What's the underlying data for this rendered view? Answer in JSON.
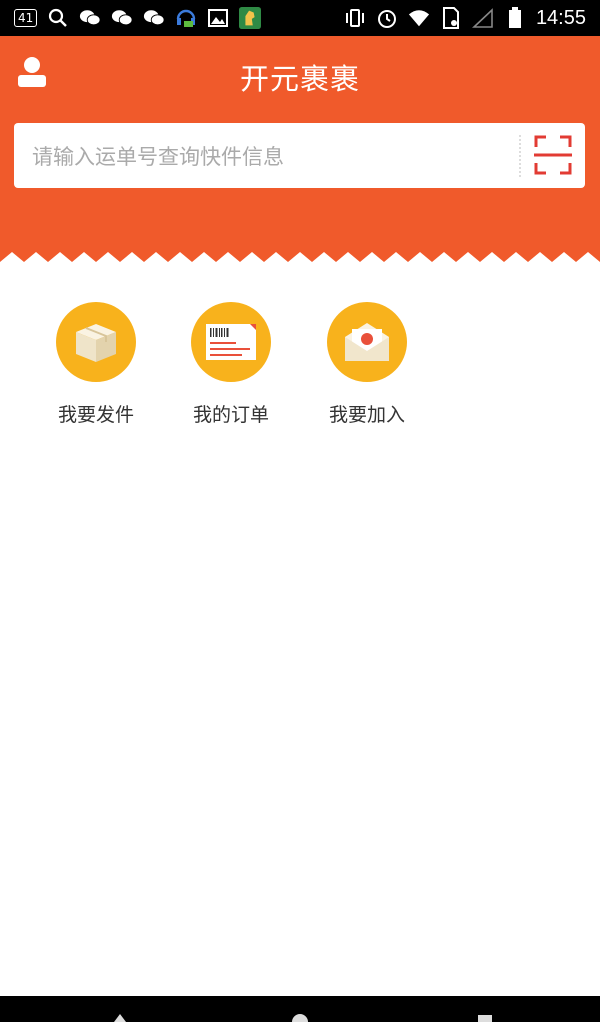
{
  "status_bar": {
    "badge": "41",
    "time": "14:55"
  },
  "header": {
    "title": "开元裹裹",
    "search_placeholder": "请输入运单号查询快件信息"
  },
  "actions": [
    {
      "label": "我要发件",
      "icon": "package-box-icon"
    },
    {
      "label": "我的订单",
      "icon": "order-receipt-icon"
    },
    {
      "label": "我要加入",
      "icon": "envelope-icon"
    }
  ],
  "colors": {
    "brand": "#f05a2b",
    "icon_bg": "#f8b21c",
    "scan_red": "#e23b33"
  }
}
